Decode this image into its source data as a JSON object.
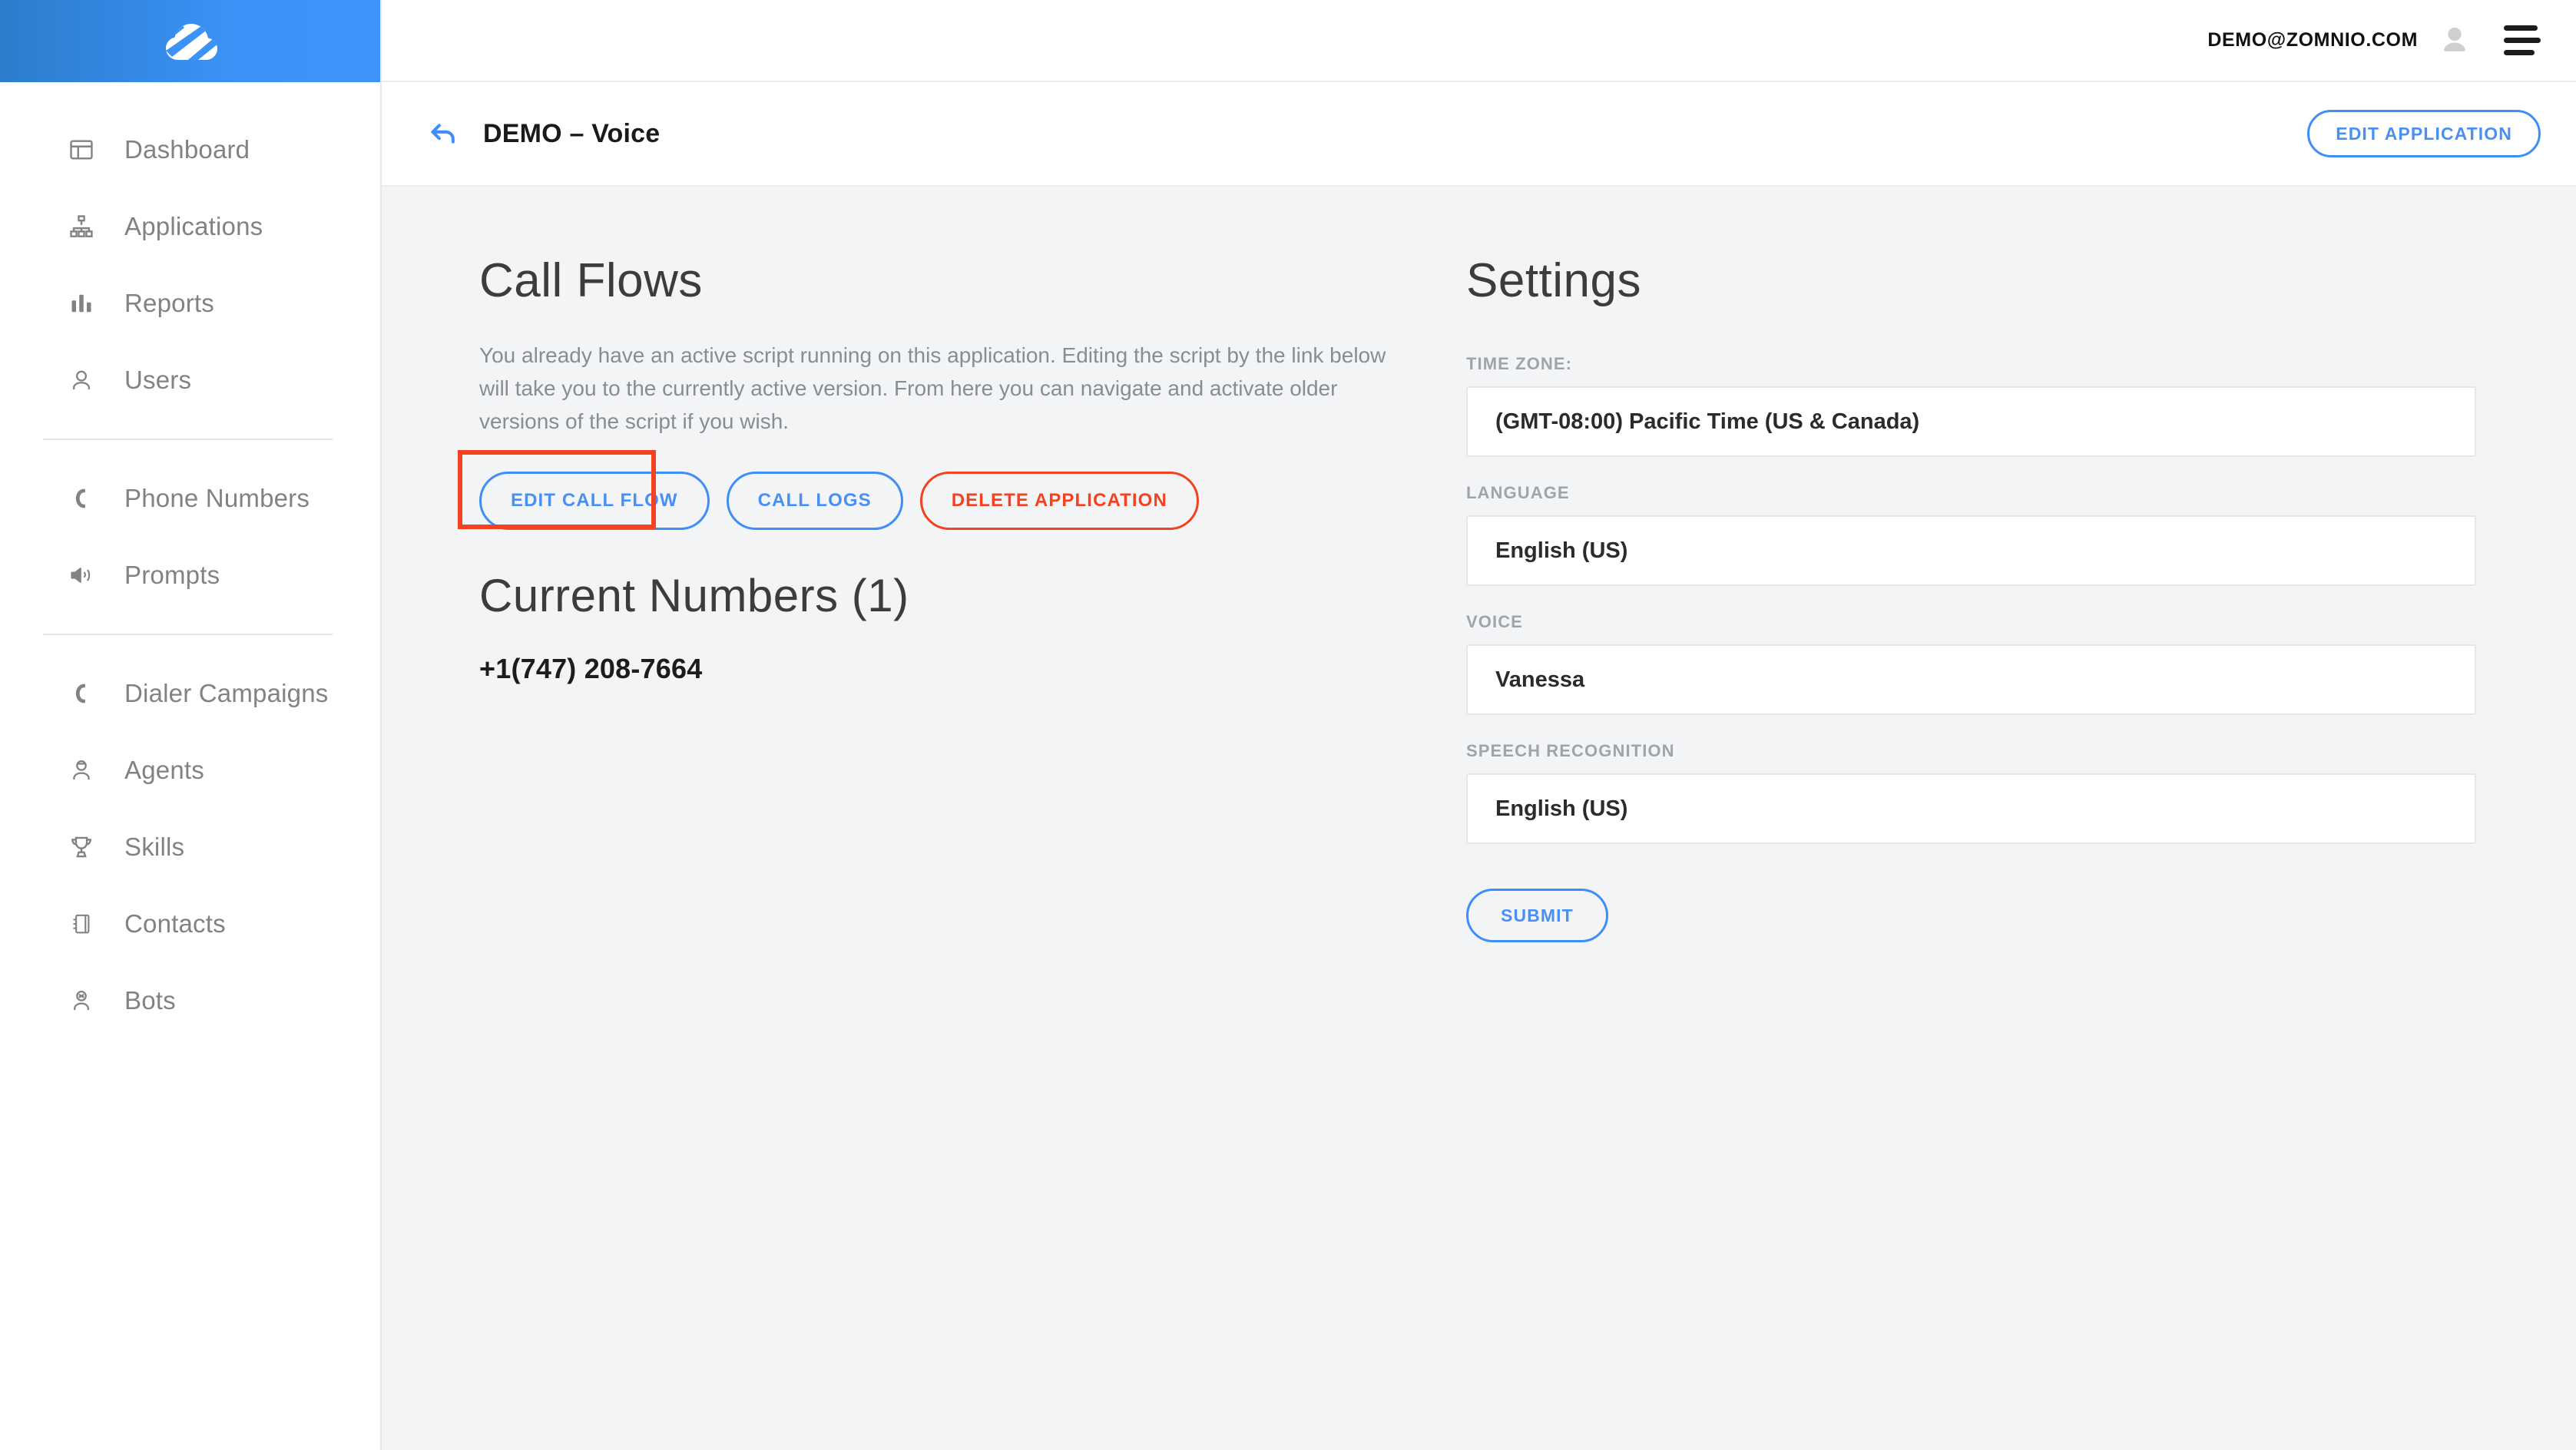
{
  "brand": {
    "logo_icon": "cloud-swoosh-logo",
    "accent": "#3b93f7"
  },
  "sidebar": {
    "groups": [
      {
        "items": [
          {
            "label": "Dashboard",
            "icon": "dashboard-icon"
          },
          {
            "label": "Applications",
            "icon": "sitemap-icon"
          },
          {
            "label": "Reports",
            "icon": "bar-chart-icon"
          },
          {
            "label": "Users",
            "icon": "user-icon"
          }
        ]
      },
      {
        "items": [
          {
            "label": "Phone Numbers",
            "icon": "phone-icon"
          },
          {
            "label": "Prompts",
            "icon": "speaker-icon"
          }
        ]
      },
      {
        "items": [
          {
            "label": "Dialer Campaigns",
            "icon": "phone-icon"
          },
          {
            "label": "Agents",
            "icon": "agent-icon"
          },
          {
            "label": "Skills",
            "icon": "trophy-icon"
          },
          {
            "label": "Contacts",
            "icon": "address-book-icon"
          },
          {
            "label": "Bots",
            "icon": "bot-icon"
          }
        ]
      }
    ]
  },
  "topbar": {
    "user_email": "DEMO@ZOMNIO.COM",
    "avatar_icon": "avatar-icon",
    "menu_icon": "hamburger-icon"
  },
  "pagebar": {
    "back_icon": "back-arrow-icon",
    "title": "DEMO – Voice",
    "edit_application_label": "EDIT APPLICATION"
  },
  "call_flows": {
    "title": "Call Flows",
    "description": "You already have an active script running on this application. Editing the script by the link below will take you to the currently active version. From here you can navigate and activate older versions of the script if you wish.",
    "buttons": {
      "edit_call_flow": "EDIT CALL FLOW",
      "call_logs": "CALL LOGS",
      "delete_application": "DELETE APPLICATION"
    },
    "annotation_color": "#f4411f"
  },
  "current_numbers": {
    "title": "Current Numbers (1)",
    "numbers": [
      "+1(747) 208-7664"
    ]
  },
  "settings": {
    "title": "Settings",
    "fields": [
      {
        "label": "TIME ZONE:",
        "value": "(GMT-08:00) Pacific Time (US & Canada)"
      },
      {
        "label": "LANGUAGE",
        "value": "English (US)"
      },
      {
        "label": "VOICE",
        "value": "Vanessa"
      },
      {
        "label": "SPEECH RECOGNITION",
        "value": "English (US)"
      }
    ],
    "submit_label": "SUBMIT"
  }
}
